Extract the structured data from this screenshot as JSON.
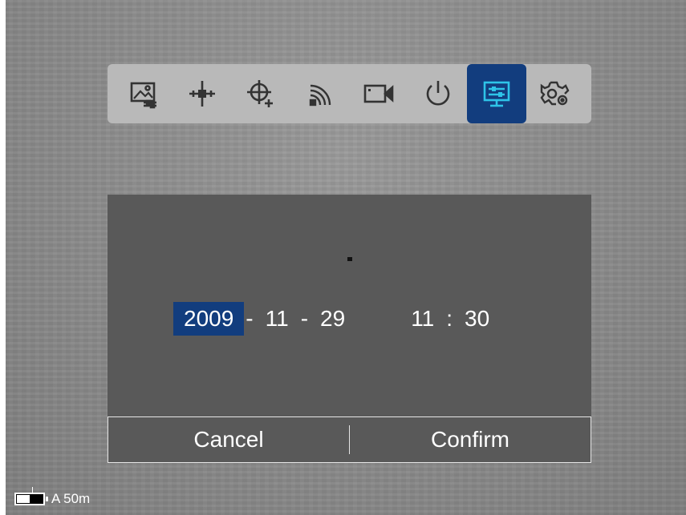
{
  "toolbar": {
    "items": [
      {
        "icon": "image-adjust-icon",
        "active": false
      },
      {
        "icon": "crosshair-icon",
        "active": false
      },
      {
        "icon": "zeroing-target-icon",
        "active": false
      },
      {
        "icon": "wifi-signal-icon",
        "active": false
      },
      {
        "icon": "video-camera-icon",
        "active": false
      },
      {
        "icon": "power-icon",
        "active": false
      },
      {
        "icon": "display-settings-icon",
        "active": true
      },
      {
        "icon": "gear-settings-icon",
        "active": false
      }
    ],
    "active_color": "#123d7e",
    "icon_color": "#333333",
    "active_icon_color": "#2ec4e8"
  },
  "dialog": {
    "date": {
      "year": "2009",
      "month": "11",
      "day": "29",
      "separator": "-"
    },
    "time": {
      "hour": "11",
      "minute": "30",
      "separator": ":"
    },
    "selected_field": "year",
    "cancel_label": "Cancel",
    "confirm_label": "Confirm"
  },
  "status": {
    "battery_level": 0.5,
    "range_text": "A 50m"
  }
}
